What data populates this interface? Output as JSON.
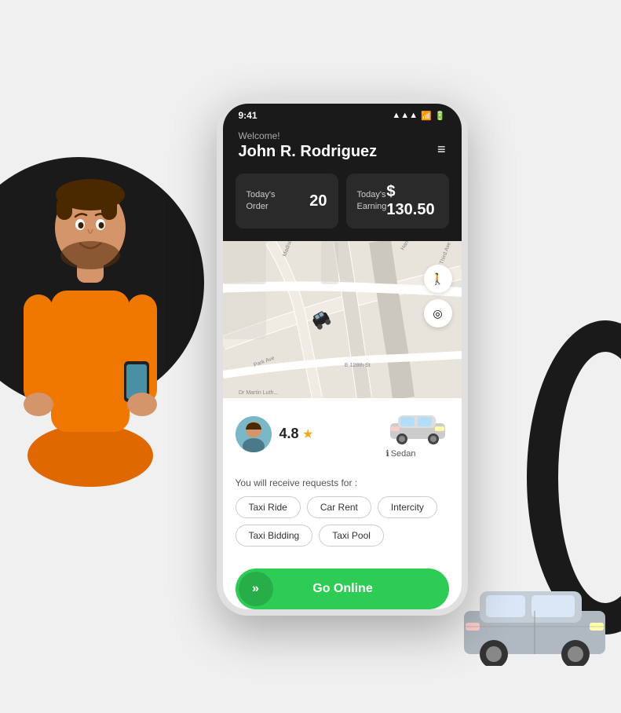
{
  "statusBar": {
    "time": "9:41",
    "signalIcon": "signal-icon",
    "wifiIcon": "wifi-icon",
    "batteryIcon": "battery-icon"
  },
  "header": {
    "welcomeText": "Welcome!",
    "userName": "John R. Rodriguez",
    "menuIcon": "≡"
  },
  "stats": {
    "order": {
      "label": "Today's\nOrder",
      "value": "20"
    },
    "earning": {
      "label": "Today's\nEarning",
      "value": "$ 130.50"
    }
  },
  "driver": {
    "rating": "4.8",
    "starIcon": "★",
    "vehicle": {
      "label": "Sedan",
      "infoIcon": "ℹ"
    }
  },
  "requests": {
    "label": "You will receive requests for :",
    "tags": [
      "Taxi Ride",
      "Car Rent",
      "Intercity",
      "Taxi Bidding",
      "Taxi Pool"
    ]
  },
  "goOnlineButton": {
    "label": "Go Online",
    "chevrons": "»"
  }
}
